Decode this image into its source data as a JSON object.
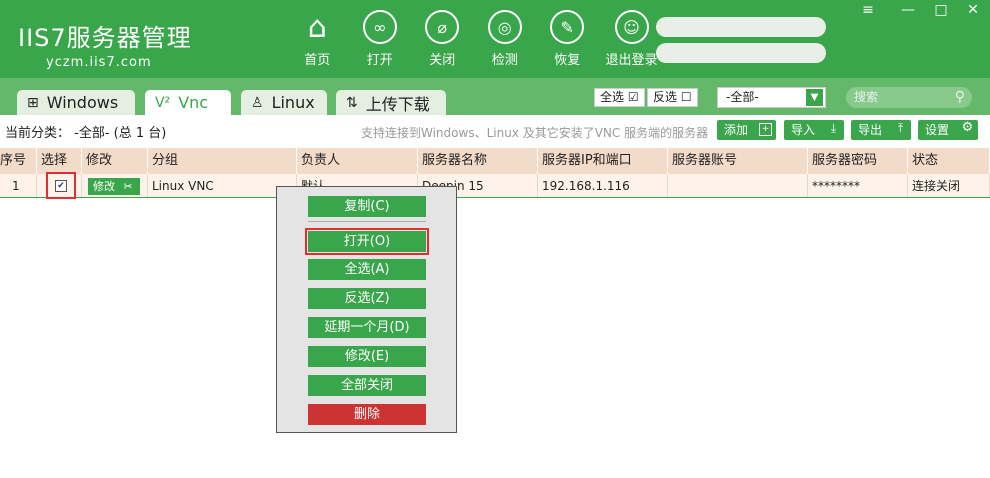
{
  "app": {
    "logo": "IIS7服务器管理",
    "domain": "yczm.iis7.com"
  },
  "nav": [
    {
      "label": "首页",
      "icon": "home-icon"
    },
    {
      "label": "打开",
      "icon": "link-icon"
    },
    {
      "label": "关闭",
      "icon": "unlink-icon"
    },
    {
      "label": "检测",
      "icon": "radar-icon"
    },
    {
      "label": "恢复",
      "icon": "wrench-icon"
    },
    {
      "label": "退出登录",
      "icon": "user-icon"
    }
  ],
  "window": {
    "menu": "≡",
    "minimize": "—",
    "maximize": "□",
    "close": "✕"
  },
  "tabs": [
    {
      "label": "Windows",
      "icon": "windows-icon"
    },
    {
      "label": "Vnc",
      "icon": "vnc-icon"
    },
    {
      "label": "Linux",
      "icon": "linux-icon"
    },
    {
      "label": "上传下载",
      "icon": "upload-download-icon"
    }
  ],
  "toolbar": {
    "select_all": "全选",
    "invert": "反选",
    "filter_value": "-全部-",
    "search_placeholder": "搜索"
  },
  "info": {
    "current_category": "当前分类：  -全部- (总 1 台)",
    "hint": "支持连接到Windows、Linux 及其它安装了VNC 服务端的服务器"
  },
  "actions": [
    "添加",
    "导入",
    "导出",
    "设置"
  ],
  "table": {
    "headers": [
      "序号",
      "选择",
      "修改",
      "分组",
      "负责人",
      "服务器名称",
      "服务器IP和端口",
      "服务器账号",
      "服务器密码",
      "状态"
    ],
    "rows": [
      {
        "index": "1",
        "checked": "✔",
        "edit": "修改",
        "group": "Linux VNC",
        "owner": "默认",
        "name": "Deepin 15",
        "ip": "192.168.1.116",
        "account": "",
        "password": "********",
        "status": "连接关闭"
      }
    ]
  },
  "context_menu": [
    "复制(C)",
    "打开(O)",
    "全选(A)",
    "反选(Z)",
    "延期一个月(D)",
    "修改(E)",
    "全部关闭",
    "删除"
  ]
}
